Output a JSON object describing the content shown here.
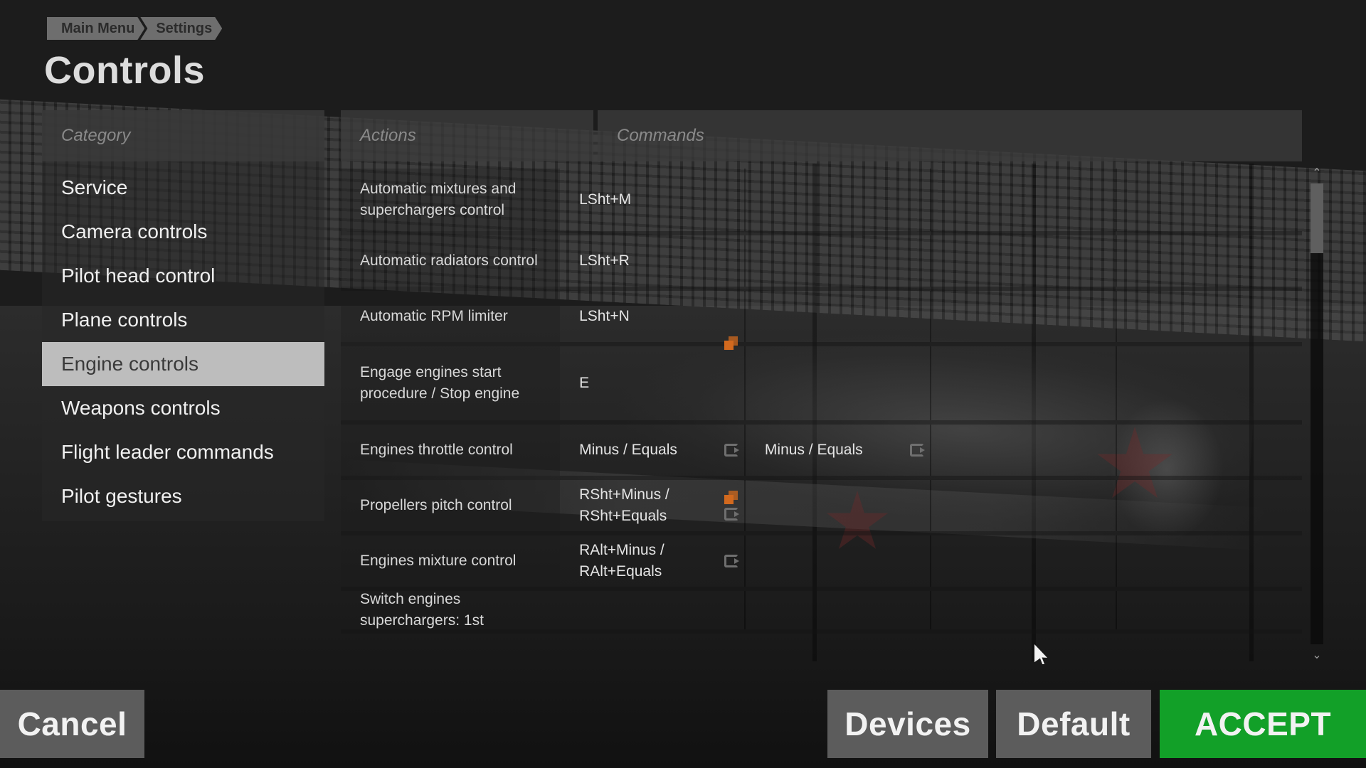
{
  "breadcrumb": [
    "Main Menu",
    "Settings"
  ],
  "page_title": "Controls",
  "category": {
    "header": "Category",
    "items": [
      {
        "label": "Service",
        "active": false
      },
      {
        "label": "Camera controls",
        "active": false
      },
      {
        "label": "Pilot head control",
        "active": false
      },
      {
        "label": "Plane controls",
        "active": false
      },
      {
        "label": "Engine controls",
        "active": true
      },
      {
        "label": "Weapons controls",
        "active": false
      },
      {
        "label": "Flight leader commands",
        "active": false
      },
      {
        "label": "Pilot gestures",
        "active": false
      }
    ]
  },
  "table": {
    "actions_header": "Actions",
    "commands_header": "Commands",
    "rows": [
      {
        "action": "Automatic mixtures and superchargers control",
        "cmd1": "LSht+M",
        "cmd1_icons": [],
        "cmd2": "",
        "cmd2_icons": []
      },
      {
        "action": "Automatic radiators control",
        "cmd1": "LSht+R",
        "cmd1_icons": [],
        "cmd2": "",
        "cmd2_icons": []
      },
      {
        "action": "Automatic RPM limiter",
        "cmd1": "LSht+N",
        "cmd1_icons": [],
        "cmd2": "",
        "cmd2_icons": []
      },
      {
        "action": "Engage engines start procedure / Stop engine",
        "cmd1": "E",
        "cmd1_icons": [
          "conflict-icon"
        ],
        "cmd2": "",
        "cmd2_icons": []
      },
      {
        "action": "Engines throttle control",
        "cmd1": "Minus / Equals",
        "cmd1_icons": [
          "axis-icon"
        ],
        "cmd2": "Minus / Equals",
        "cmd2_icons": [
          "axis-icon"
        ]
      },
      {
        "action": "Propellers pitch control",
        "cmd1": "RSht+Minus / RSht+Equals",
        "cmd1_icons": [
          "conflict-icon",
          "axis-icon"
        ],
        "cmd2": "",
        "cmd2_icons": []
      },
      {
        "action": "Engines mixture control",
        "cmd1": "RAlt+Minus / RAlt+Equals",
        "cmd1_icons": [
          "axis-icon"
        ],
        "cmd2": "",
        "cmd2_icons": []
      },
      {
        "action": "Switch engines superchargers: 1st",
        "cmd1": "",
        "cmd1_icons": [],
        "cmd2": "",
        "cmd2_icons": []
      }
    ]
  },
  "buttons": {
    "cancel": "Cancel",
    "devices": "Devices",
    "default": "Default",
    "accept": "ACCEPT"
  },
  "colors": {
    "accept": "#12a028",
    "conflict_icon": "#d2691e",
    "active_category_bg": "#bdbdbd"
  }
}
